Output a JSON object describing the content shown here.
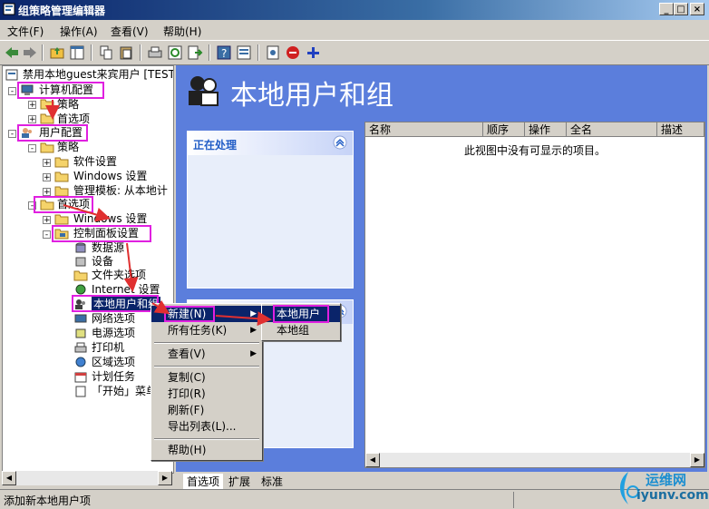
{
  "window": {
    "title": "组策略管理编辑器"
  },
  "menu": [
    "文件(F)",
    "操作(A)",
    "查看(V)",
    "帮助(H)"
  ],
  "tree": {
    "root": "禁用本地guest来宾用户 [TEST-",
    "computer_config": "计算机配置",
    "policy": "策略",
    "preferences": "首选项",
    "user_config": "用户配置",
    "software_settings": "软件设置",
    "windows_settings": "Windows 设置",
    "admin_templates": "管理模板: 从本地计",
    "pref_windows_settings": "Windows 设置",
    "control_panel": "控制面板设置",
    "leaves": [
      "数据源",
      "设备",
      "文件夹选项",
      "Internet 设置",
      "本地用户和组",
      "网络选项",
      "电源选项",
      "打印机",
      "区域选项",
      "计划任务",
      "「开始」菜单"
    ]
  },
  "right": {
    "title": "本地用户和组",
    "task_title": "正在处理",
    "columns": [
      "名称",
      "顺序",
      "操作",
      "全名",
      "描述"
    ],
    "empty_text": "此视图中没有可显示的项目。"
  },
  "context_menu": {
    "items": [
      "新建(N)",
      "所有任务(K)",
      "查看(V)",
      "复制(C)",
      "打印(R)",
      "刷新(F)",
      "导出列表(L)...",
      "帮助(H)"
    ]
  },
  "submenu": {
    "items": [
      "本地用户",
      "本地组"
    ]
  },
  "tabs": [
    "首选项",
    "扩展",
    "标准"
  ],
  "status": "添加新本地用户项",
  "watermark": {
    "text": "运维网",
    "url": "iyunv.com"
  },
  "colors": {
    "highlight": "#e020e0",
    "selection": "#0a246a",
    "pane": "#5b7edc",
    "arrow": "#e03030"
  }
}
